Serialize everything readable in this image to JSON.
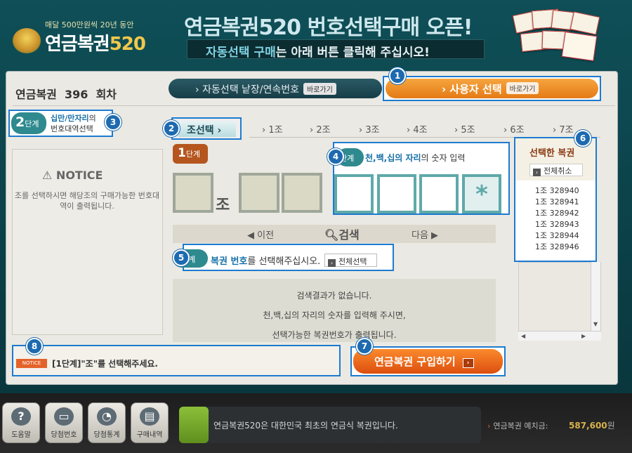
{
  "header": {
    "logo_tagline": "매달 500만원씩 20년 동안",
    "logo_name": "연금복권",
    "logo_number": "520",
    "title": "연금복권520 번호선택구매 오픈!",
    "subtitle_hl": "자동선택 구매",
    "subtitle_rest": "는 아래 버튼 클릭해 주십시오!"
  },
  "round": {
    "label": "연금복권",
    "number": "396",
    "suffix": "회차"
  },
  "auto_select": {
    "label": "자동선택 낱장/연속번호",
    "go": "바로가기"
  },
  "user_select": {
    "label": "사용자 선택",
    "go": "바로가기"
  },
  "steps": {
    "n1": "1",
    "n2": "2",
    "n3": "3",
    "n4": "4",
    "n5": "5",
    "n6": "6",
    "n7": "7",
    "n8": "8"
  },
  "step2": {
    "num": "2",
    "unit": "단계",
    "line1_hl": "십만/만자리",
    "line1_rest": "의",
    "line2": "번호대역선택"
  },
  "notice": {
    "title": "NOTICE",
    "text": "조를 선택하시면 해당조의 구매가능한 번호대역이 출력됩니다."
  },
  "jo": {
    "active": "조선택",
    "tabs": [
      "1조",
      "2조",
      "3조",
      "4조",
      "5조",
      "6조",
      "7조"
    ]
  },
  "step1": {
    "num": "1",
    "unit": "단계",
    "jo_label": "조"
  },
  "step4": {
    "unit": "단계",
    "text_hl": "천,백,십의 자리",
    "text_rest": "의 숫자 입력",
    "star": "*"
  },
  "nav": {
    "prev": "◀ 이전",
    "search": "검색",
    "next": "다음 ▶"
  },
  "step5": {
    "unit": "단계",
    "text_hl": "복권 번호",
    "text_rest": "를 선택해주십시오.",
    "select_all": "전체선택"
  },
  "result": {
    "line1": "검색결과가 없습니다.",
    "line2": "천,백,십의 자리의 숫자를 입력해 주시면,",
    "line3": "선택가능한 복권번호가 출력됩니다."
  },
  "selected": {
    "title": "선택한 복권",
    "cancel_all": "전체취소",
    "items": [
      "1조 328940",
      "1조 328941",
      "1조 328942",
      "1조 328943",
      "1조 328944",
      "1조 328946"
    ]
  },
  "message": {
    "tag": "NOTICE",
    "text": "[1단계]\"조\"를 선택해주세요."
  },
  "buy": {
    "label": "연금복권 구입하기"
  },
  "dock": [
    "도움말",
    "당첨번호",
    "당첨통계",
    "구매내역"
  ],
  "ticker": "연금복권520은 대한민국 최초의 연금식 복권입니다.",
  "deposit": {
    "label": "연금복권 예치금:",
    "value": "587,600",
    "unit": "원"
  },
  "colors": {
    "accent_blue": "#1d7bd0",
    "orange": "#e47b16",
    "teal": "#2e8a8f"
  }
}
